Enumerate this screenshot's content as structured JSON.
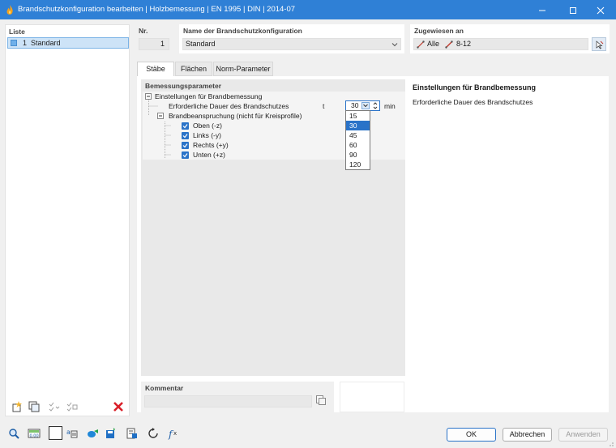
{
  "window": {
    "title": "Brandschutzkonfiguration bearbeiten | Holzbemessung | EN 1995 | DIN | 2014-07"
  },
  "list": {
    "header": "Liste",
    "items": [
      {
        "number": "1",
        "name": "Standard"
      }
    ]
  },
  "nr": {
    "header": "Nr.",
    "value": "1"
  },
  "config_name": {
    "header": "Name der Brandschutzkonfiguration",
    "value": "Standard"
  },
  "assigned": {
    "header": "Zugewiesen an",
    "all_label": "Alle",
    "members_label": "8-12"
  },
  "tabs": [
    {
      "label": "Stäbe",
      "active": true
    },
    {
      "label": "Flächen",
      "active": false
    },
    {
      "label": "Norm-Parameter",
      "active": false
    }
  ],
  "params": {
    "header": "Bemessungsparameter",
    "group1": "Einstellungen für Brandbemessung",
    "duration_label": "Erforderliche Dauer des Brandschutzes",
    "duration_symbol": "t",
    "duration_value": "30",
    "duration_unit": "min",
    "group2": "Brandbeanspruchung (nicht für Kreisprofile)",
    "exposures": [
      {
        "label": "Oben (-z)",
        "checked": true
      },
      {
        "label": "Links (-y)",
        "checked": true
      },
      {
        "label": "Rechts (+y)",
        "checked": true
      },
      {
        "label": "Unten (+z)",
        "checked": true
      }
    ],
    "dropdown_options": [
      "15",
      "30",
      "45",
      "60",
      "90",
      "120"
    ],
    "dropdown_selected": "30"
  },
  "info": {
    "title": "Einstellungen für Brandbemessung",
    "text": "Erforderliche Dauer des Brandschutzes"
  },
  "comment": {
    "header": "Kommentar",
    "value": ""
  },
  "buttons": {
    "ok": "OK",
    "cancel": "Abbrechen",
    "apply": "Anwenden"
  },
  "colors": {
    "titlebar": "#2f80d6",
    "accent": "#2a73c8",
    "delete": "#d9202a"
  }
}
